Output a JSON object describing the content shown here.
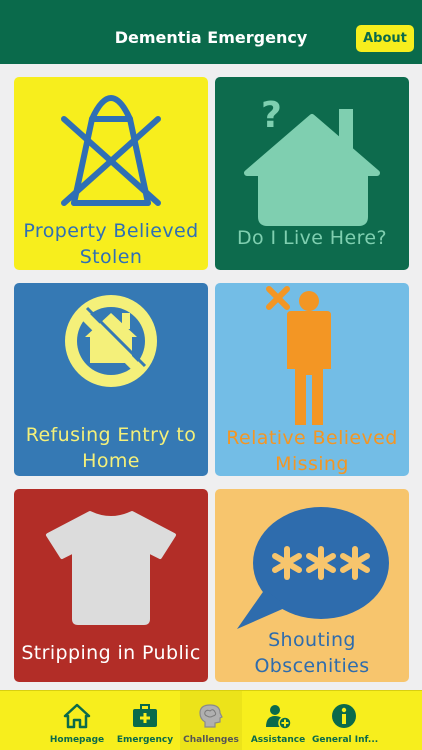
{
  "header": {
    "title": "Dementia Emergency",
    "about_label": "About"
  },
  "tiles": [
    {
      "label_lines": [
        "Property Believed",
        "Stolen"
      ],
      "icon": "shopping-bag-crossed-icon"
    },
    {
      "label_lines": [
        "Do I Live Here?"
      ],
      "icon": "house-question-icon"
    },
    {
      "label_lines": [
        "Refusing Entry to",
        "Home"
      ],
      "icon": "no-entry-house-icon"
    },
    {
      "label_lines": [
        "Relative Believed",
        "Missing"
      ],
      "icon": "missing-person-icon"
    },
    {
      "label_lines": [
        "Stripping in Public"
      ],
      "icon": "tshirt-icon"
    },
    {
      "label_lines": [
        "Shouting",
        "Obscenities"
      ],
      "icon": "speech-bubble-asterisks-icon"
    }
  ],
  "tabs": [
    {
      "label": "Homepage",
      "icon": "home-icon",
      "active": false
    },
    {
      "label": "Emergency",
      "icon": "first-aid-kit-icon",
      "active": false
    },
    {
      "label": "Challenges",
      "icon": "brain-head-icon",
      "active": true
    },
    {
      "label": "Assistance",
      "icon": "person-add-icon",
      "active": false
    },
    {
      "label": "General Inf...",
      "icon": "info-icon",
      "active": false
    }
  ],
  "colors": {
    "header_bg": "#0a6a4b",
    "accent_yellow": "#f7ee1d",
    "tile_dark_green": "#0d6b4d",
    "tile_blue": "#3579b4",
    "tile_light_blue": "#73bde6",
    "tile_red": "#b22d27",
    "tile_peach": "#f7c56d"
  }
}
